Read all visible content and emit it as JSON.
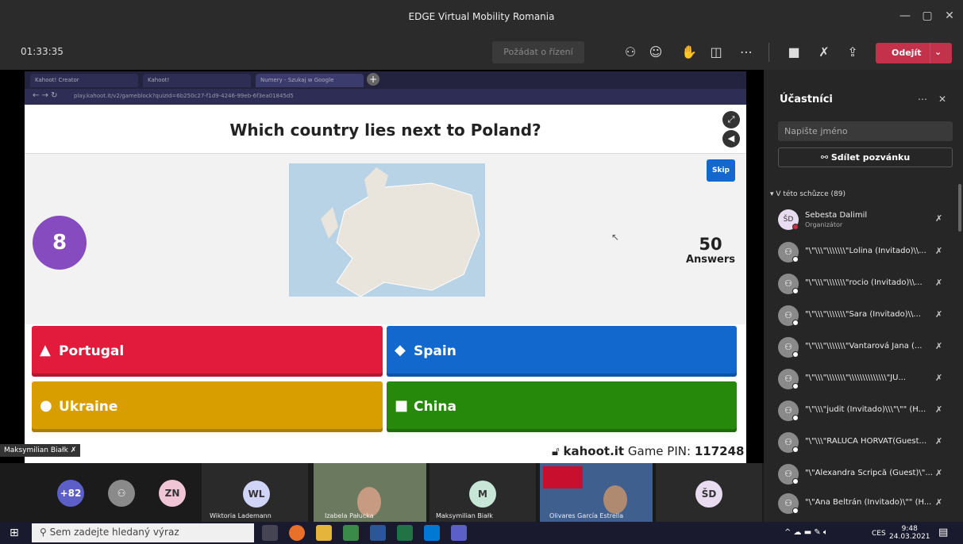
{
  "window": {
    "title": "EDGE Virtual Mobility Romania"
  },
  "toolbar": {
    "timer": "01:33:35",
    "request_control": "Požádat o řízení",
    "leave": "Odejít"
  },
  "browser": {
    "tabs": [
      "Kahoot! Creator",
      "Kahoot!",
      "Numery - Szukaj w Google"
    ],
    "url": "play.kahoot.it/v2/gameblock?quizId=6b250c27-f1d9-4246-99eb-6f3ea01845d5"
  },
  "kahoot": {
    "question": "Which country lies next to Poland?",
    "timer": "8",
    "answers_count": "50",
    "answers_label": "Answers",
    "skip": "Skip",
    "options": [
      {
        "label": "Portugal",
        "symbol": "▲",
        "color": "#e21b3c"
      },
      {
        "label": "Spain",
        "symbol": "◆",
        "color": "#1368ce"
      },
      {
        "label": "Ukraine",
        "symbol": "●",
        "color": "#d89e00"
      },
      {
        "label": "China",
        "symbol": "■",
        "color": "#26890c"
      }
    ],
    "site": "kahoot.it",
    "game_pin_label": "Game PIN:",
    "game_pin": "117248",
    "presenter": "Maksymilian Białk"
  },
  "gallery": {
    "overflow": "+82",
    "initials": [
      "ZN",
      "WL",
      "M",
      "ŠD"
    ],
    "names": [
      "Wiktoria Lademann",
      "Izabela Pałucka",
      "Maksymilian Białk",
      "Olivares García Estrella"
    ]
  },
  "panel": {
    "title": "Účastníci",
    "search_placeholder": "Napište jméno",
    "share": "Sdílet pozvánku",
    "section": "V této schůzce (89)",
    "organizer_initials": "ŠD",
    "organizer_name": "Šebesta Dalimil",
    "organizer_role": "Organizátor",
    "participants": [
      "\"\\\"\\\\\\\"\\\\\\\\\\\\\\\"Lolina (Invitado)\\\\...",
      "\"\\\"\\\\\\\"\\\\\\\\\\\\\\\"rocio (Invitado)\\\\...",
      "\"\\\"\\\\\\\"\\\\\\\\\\\\\\\"Sara (Invitado)\\\\...",
      "\"\\\"\\\\\\\"\\\\\\\\\\\\\\\"Vantarová Jana (...",
      "\"\\\"\\\\\\\"\\\\\\\\\\\\\\\"\\\\\\\\\\\\\\\\\\\\\\\\\\\\\"JU...",
      "\"\\\"\\\\\\\"judit (Invitado)\\\\\\\"\\\"\" (H...",
      "\"\\\"\\\\\\\"RALUCA HORVAT(Guest...",
      "\"\\\"Alexandra Scripcă (Guest)\\\"...",
      "\"\\\"Ana Beltrán (Invitado)\\\"\" (H..."
    ]
  },
  "taskbar": {
    "search": "Sem zadejte hledaný výraz",
    "lang": "CES",
    "time": "9:48",
    "date": "24.03.2021"
  }
}
